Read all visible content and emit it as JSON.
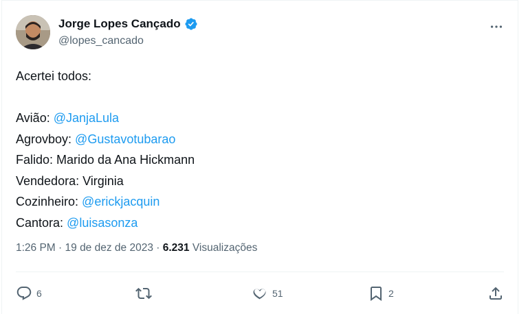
{
  "author": {
    "display_name": "Jorge Lopes Cançado",
    "handle": "@lopes_cancado"
  },
  "tweet": {
    "intro": "Acertei todos:",
    "lines": [
      {
        "label": "Avião: ",
        "value": "@JanjaLula",
        "is_mention": true
      },
      {
        "label": "Agrovboy: ",
        "value": "@Gustavotubarao",
        "is_mention": true
      },
      {
        "label": "Falido: ",
        "value": "Marido da Ana Hickmann",
        "is_mention": false
      },
      {
        "label": "Vendedora: ",
        "value": "Virginia",
        "is_mention": false
      },
      {
        "label": "Cozinheiro: ",
        "value": "@erickjacquin",
        "is_mention": true
      },
      {
        "label": "Cantora: ",
        "value": "@luisasonza",
        "is_mention": true
      }
    ]
  },
  "meta": {
    "time": "1:26 PM",
    "separator": " · ",
    "date": "19 de dez de 2023",
    "views_count": "6.231",
    "views_label": " Visualizações"
  },
  "actions": {
    "replies": "6",
    "retweets": "",
    "likes": "51",
    "bookmarks": "2"
  },
  "icons": {
    "verified": "verified-badge-icon",
    "more": "more-dots-icon",
    "reply": "reply-bubble-icon",
    "retweet": "retweet-icon",
    "like": "heart-icon",
    "bookmark": "bookmark-icon",
    "share": "share-icon"
  },
  "colors": {
    "mention": "#1d9bf0",
    "verified": "#1d9bf0",
    "secondary_text": "#536471",
    "primary_text": "#0f1419"
  }
}
